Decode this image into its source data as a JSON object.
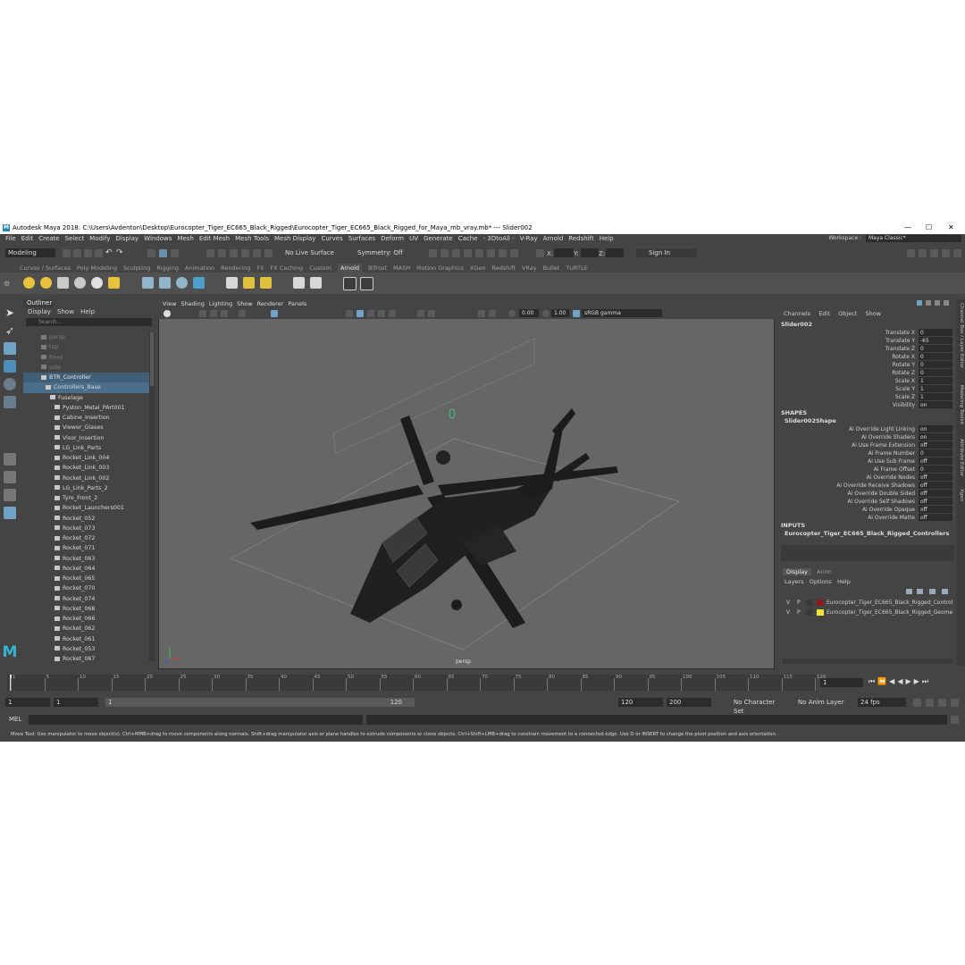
{
  "title": "Autodesk Maya 2018: C:\\Users\\Avdenton\\Desktop\\Eurocopter_Tiger_EC665_Black_Rigged\\Eurocopter_Tiger_EC665_Black_Rigged_for_Maya_mb_vray.mb*  ---  Slider002",
  "window_controls": [
    "—",
    "☐",
    "✕"
  ],
  "menu": [
    "File",
    "Edit",
    "Create",
    "Select",
    "Modify",
    "Display",
    "Windows",
    "Mesh",
    "Edit Mesh",
    "Mesh Tools",
    "Mesh Display",
    "Curves",
    "Surfaces",
    "Deform",
    "UV",
    "Generate",
    "Cache",
    "- 3DtoAll -",
    "V-Ray",
    "Arnold",
    "Redshift",
    "Help"
  ],
  "workspace": {
    "label": "Workspace :",
    "value": "Maya Classic*"
  },
  "status": {
    "mode": "Modeling",
    "live_surface": "No Live Surface",
    "symmetry": "Symmetry: Off",
    "sign_in": "Sign In",
    "x": "X:",
    "y": "Y:",
    "z": "Z:"
  },
  "shelf_tabs": [
    "Curves / Surfaces",
    "Poly Modeling",
    "Sculpting",
    "Rigging",
    "Animation",
    "Rendering",
    "FX",
    "FX Caching",
    "Custom",
    "Arnold",
    "Bifrost",
    "MASH",
    "Motion Graphics",
    "XGen",
    "Redshift",
    "VRay",
    "Bullet",
    "TURTLE"
  ],
  "shelf_active": "Arnold",
  "outliner": {
    "title": "Outliner",
    "menus": [
      "Display",
      "Show",
      "Help"
    ],
    "search_placeholder": "Search...",
    "items": [
      {
        "label": "persp",
        "depth": 0,
        "style": "dim"
      },
      {
        "label": "top",
        "depth": 0,
        "style": "dim"
      },
      {
        "label": "front",
        "depth": 0,
        "style": "dim"
      },
      {
        "label": "side",
        "depth": 0,
        "style": "dim"
      },
      {
        "label": "BTR_Controller",
        "depth": 0,
        "style": "sel"
      },
      {
        "label": "Controllers_Base",
        "depth": 1,
        "style": "sel2"
      },
      {
        "label": "Fuselage",
        "depth": 2,
        "style": ""
      },
      {
        "label": "Pyston_Metal_PArt001",
        "depth": 3,
        "style": ""
      },
      {
        "label": "Cabine_Insertion",
        "depth": 3,
        "style": ""
      },
      {
        "label": "Viewer_Glases",
        "depth": 3,
        "style": ""
      },
      {
        "label": "Visor_Insertion",
        "depth": 3,
        "style": ""
      },
      {
        "label": "LG_Link_Parts",
        "depth": 3,
        "style": ""
      },
      {
        "label": "Rocket_Link_004",
        "depth": 3,
        "style": ""
      },
      {
        "label": "Rocket_Link_003",
        "depth": 3,
        "style": ""
      },
      {
        "label": "Rocket_Link_002",
        "depth": 3,
        "style": ""
      },
      {
        "label": "LG_Link_Parts_2",
        "depth": 3,
        "style": ""
      },
      {
        "label": "Tyre_Front_2",
        "depth": 3,
        "style": ""
      },
      {
        "label": "Rocket_Launchers001",
        "depth": 3,
        "style": ""
      },
      {
        "label": "Rocket_052",
        "depth": 3,
        "style": ""
      },
      {
        "label": "Rocket_073",
        "depth": 3,
        "style": ""
      },
      {
        "label": "Rocket_072",
        "depth": 3,
        "style": ""
      },
      {
        "label": "Rocket_071",
        "depth": 3,
        "style": ""
      },
      {
        "label": "Rocket_063",
        "depth": 3,
        "style": ""
      },
      {
        "label": "Rocket_064",
        "depth": 3,
        "style": ""
      },
      {
        "label": "Rocket_065",
        "depth": 3,
        "style": ""
      },
      {
        "label": "Rocket_070",
        "depth": 3,
        "style": ""
      },
      {
        "label": "Rocket_074",
        "depth": 3,
        "style": ""
      },
      {
        "label": "Rocket_068",
        "depth": 3,
        "style": ""
      },
      {
        "label": "Rocket_066",
        "depth": 3,
        "style": ""
      },
      {
        "label": "Rocket_062",
        "depth": 3,
        "style": ""
      },
      {
        "label": "Rocket_061",
        "depth": 3,
        "style": ""
      },
      {
        "label": "Rocket_053",
        "depth": 3,
        "style": ""
      },
      {
        "label": "Rocket_067",
        "depth": 3,
        "style": ""
      }
    ]
  },
  "viewport": {
    "menus": [
      "View",
      "Shading",
      "Lighting",
      "Show",
      "Renderer",
      "Panels"
    ],
    "exposure": "0.00",
    "gamma": "1.00",
    "color_space": "sRGB gamma",
    "camera_label": "persp"
  },
  "channel_box": {
    "menus": [
      "Channels",
      "Edit",
      "Object",
      "Show"
    ],
    "object": "Slider002",
    "channels": [
      {
        "name": "Translate X",
        "value": "0"
      },
      {
        "name": "Translate Y",
        "value": "-65"
      },
      {
        "name": "Translate Z",
        "value": "0"
      },
      {
        "name": "Rotate X",
        "value": "0"
      },
      {
        "name": "Rotate Y",
        "value": "0"
      },
      {
        "name": "Rotate Z",
        "value": "0"
      },
      {
        "name": "Scale X",
        "value": "1"
      },
      {
        "name": "Scale Y",
        "value": "1"
      },
      {
        "name": "Scale Z",
        "value": "1"
      },
      {
        "name": "Visibility",
        "value": "on"
      }
    ],
    "shapes_header": "SHAPES",
    "shape_name": "Slider002Shape",
    "shape_attrs": [
      {
        "name": "Ai Override Light Linking",
        "value": "on"
      },
      {
        "name": "Ai Override Shaders",
        "value": "on"
      },
      {
        "name": "Ai Use Frame Extension",
        "value": "off"
      },
      {
        "name": "Ai Frame Number",
        "value": "0"
      },
      {
        "name": "Ai Use Sub Frame",
        "value": "off"
      },
      {
        "name": "Ai Frame Offset",
        "value": "0"
      },
      {
        "name": "Ai Override Nodes",
        "value": "off"
      },
      {
        "name": "Ai Override Receive Shadows",
        "value": "off"
      },
      {
        "name": "Ai Override Double Sided",
        "value": "off"
      },
      {
        "name": "Ai Override Self Shadows",
        "value": "off"
      },
      {
        "name": "Ai Override Opaque",
        "value": "off"
      },
      {
        "name": "Ai Override Matte",
        "value": "off"
      }
    ],
    "inputs_header": "INPUTS",
    "input_name": "Eurocopter_Tiger_EC665_Black_Rigged_Controllers"
  },
  "side_tabs": [
    "Channel Box / Layer Editor",
    "Modeling Toolkit",
    "Attribute Editor",
    "Xgen"
  ],
  "layer_editor": {
    "tabs": [
      "Display",
      "Anim"
    ],
    "menus": [
      "Layers",
      "Options",
      "Help"
    ],
    "layers": [
      {
        "v": "V",
        "p": "P",
        "color": "#8b1a1a",
        "name": "Eurocopter_Tiger_EC665_Black_Rigged_Controllers"
      },
      {
        "v": "V",
        "p": "P",
        "color": "#f0e040",
        "name": "Eurocopter_Tiger_EC665_Black_Rigged_Geometry"
      }
    ]
  },
  "timeline": {
    "ticks": [
      "1",
      "5",
      "10",
      "15",
      "20",
      "25",
      "30",
      "35",
      "40",
      "45",
      "50",
      "55",
      "60",
      "65",
      "70",
      "75",
      "80",
      "85",
      "90",
      "95",
      "100",
      "105",
      "110",
      "115",
      "120"
    ],
    "current_frame": "1"
  },
  "range": {
    "start": "1",
    "start2": "1",
    "slider_start": "1",
    "slider_end": "120",
    "end": "120",
    "end2": "200",
    "character_set": "No Character Set",
    "anim_layer": "No Anim Layer",
    "fps": "24 fps"
  },
  "command": {
    "lang": "MEL"
  },
  "help_text": "Move Tool: Use manipulator to move object(s). Ctrl+MMB+drag to move components along normals. Shift+drag manipulator axis or plane handles to extrude components or clone objects. Ctrl+Shift+LMB+drag to constrain movement to a connected edge. Use D or INSERT to change the pivot position and axis orientation."
}
